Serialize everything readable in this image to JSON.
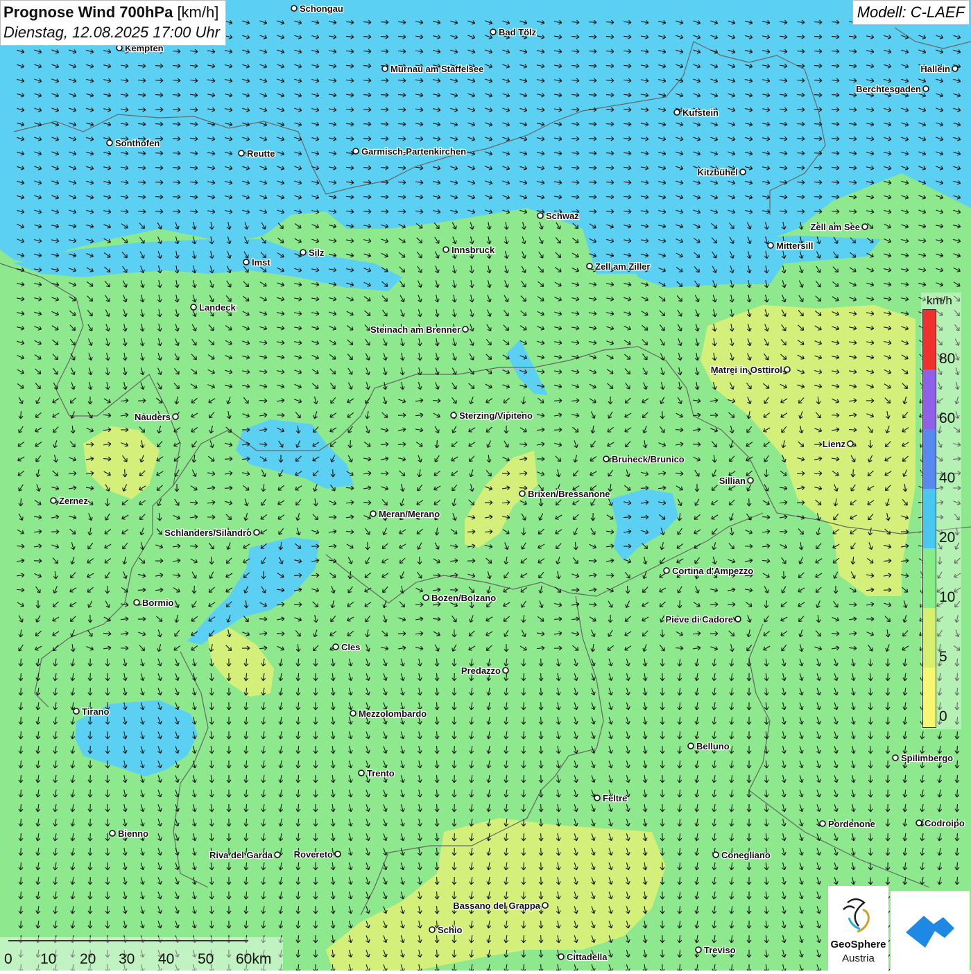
{
  "header": {
    "title_bold": "Prognose Wind 700hPa",
    "title_unit": "[km/h]",
    "subtitle": "Dienstag, 12.08.2025 17:00 Uhr",
    "model": "Modell: C-LAEF"
  },
  "legend": {
    "unit": "km/h",
    "segments": [
      {
        "from": 0,
        "to": 5,
        "color": "#f8f870"
      },
      {
        "from": 5,
        "to": 10,
        "color": "#d8f070"
      },
      {
        "from": 10,
        "to": 20,
        "color": "#88ec88"
      },
      {
        "from": 20,
        "to": 40,
        "color": "#48c8f0"
      },
      {
        "from": 40,
        "to": 60,
        "color": "#5888f0"
      },
      {
        "from": 60,
        "to": 80,
        "color": "#9060e8"
      },
      {
        "from": 80,
        "to": 100,
        "color": "#f03030"
      }
    ],
    "labels": [
      "80",
      "60",
      "40",
      "20",
      "10",
      "5",
      "0"
    ]
  },
  "scale_bar": {
    "labels": [
      "0",
      "10",
      "20",
      "30",
      "40",
      "50",
      "60km"
    ]
  },
  "cities": [
    {
      "name": "Schongau",
      "anchor": "right"
    },
    {
      "name": "Bad Tölz",
      "anchor": "right"
    },
    {
      "name": "Kempten",
      "anchor": "right"
    },
    {
      "name": "Murnau am Staffelsee",
      "anchor": "right"
    },
    {
      "name": "Hallein",
      "anchor": "left"
    },
    {
      "name": "Berchtesgaden",
      "anchor": "left"
    },
    {
      "name": "Kufstein",
      "anchor": "right"
    },
    {
      "name": "Sonthofen",
      "anchor": "right"
    },
    {
      "name": "Reutte",
      "anchor": "right"
    },
    {
      "name": "Garmisch-Partenkirchen",
      "anchor": "right"
    },
    {
      "name": "Kitzbühel",
      "anchor": "left"
    },
    {
      "name": "Schwaz",
      "anchor": "right"
    },
    {
      "name": "Zell am See",
      "anchor": "left"
    },
    {
      "name": "Silz",
      "anchor": "right"
    },
    {
      "name": "Innsbruck",
      "anchor": "right"
    },
    {
      "name": "Mittersill",
      "anchor": "right"
    },
    {
      "name": "Imst",
      "anchor": "right"
    },
    {
      "name": "Zell am Ziller",
      "anchor": "right"
    },
    {
      "name": "Landeck",
      "anchor": "right"
    },
    {
      "name": "Steinach am Brenner",
      "anchor": "left"
    },
    {
      "name": "Matrei in Osttirol",
      "anchor": "left"
    },
    {
      "name": "Nauders",
      "anchor": "left"
    },
    {
      "name": "Sterzing/Vipiteno",
      "anchor": "right"
    },
    {
      "name": "Lienz",
      "anchor": "left"
    },
    {
      "name": "Bruneck/Brunico",
      "anchor": "right"
    },
    {
      "name": "Sillian",
      "anchor": "left"
    },
    {
      "name": "Brixen/Bressanone",
      "anchor": "right"
    },
    {
      "name": "Zernez",
      "anchor": "right"
    },
    {
      "name": "Meran/Merano",
      "anchor": "right"
    },
    {
      "name": "Schlanders/Silandro",
      "anchor": "left"
    },
    {
      "name": "Cortina d'Ampezzo",
      "anchor": "right"
    },
    {
      "name": "Bozen/Bolzano",
      "anchor": "right"
    },
    {
      "name": "Bormio",
      "anchor": "right"
    },
    {
      "name": "Pieve di Cadore",
      "anchor": "left"
    },
    {
      "name": "Cles",
      "anchor": "right"
    },
    {
      "name": "Predazzo",
      "anchor": "left"
    },
    {
      "name": "Tirano",
      "anchor": "right"
    },
    {
      "name": "Mezzolombardo",
      "anchor": "right"
    },
    {
      "name": "Belluno",
      "anchor": "right"
    },
    {
      "name": "Spilimbergo",
      "anchor": "right"
    },
    {
      "name": "Trento",
      "anchor": "right"
    },
    {
      "name": "Feltre",
      "anchor": "right"
    },
    {
      "name": "Pordenone",
      "anchor": "right"
    },
    {
      "name": "Codroipo",
      "anchor": "right"
    },
    {
      "name": "Bienno",
      "anchor": "right"
    },
    {
      "name": "Riva del Garda",
      "anchor": "left"
    },
    {
      "name": "Rovereto",
      "anchor": "left"
    },
    {
      "name": "Conegliano",
      "anchor": "right"
    },
    {
      "name": "Bassano del Grappa",
      "anchor": "left"
    },
    {
      "name": "Schio",
      "anchor": "right"
    },
    {
      "name": "Treviso",
      "anchor": "right"
    },
    {
      "name": "Cittadella",
      "anchor": "right"
    }
  ],
  "logos": {
    "geosphere_line1": "GeoSphere",
    "geosphere_line2": "Austria"
  }
}
